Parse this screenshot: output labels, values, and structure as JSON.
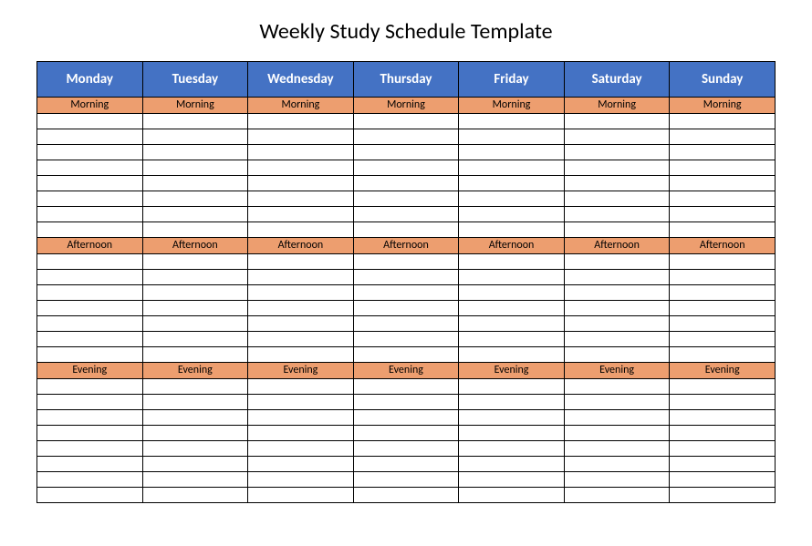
{
  "title": "Weekly Study Schedule Template",
  "days": [
    "Monday",
    "Tuesday",
    "Wednesday",
    "Thursday",
    "Friday",
    "Saturday",
    "Sunday"
  ],
  "sections": {
    "morning": {
      "label": "Morning",
      "blank_rows": 8
    },
    "afternoon": {
      "label": "Afternoon",
      "blank_rows": 7
    },
    "evening": {
      "label": "Evening",
      "blank_rows": 8
    }
  }
}
